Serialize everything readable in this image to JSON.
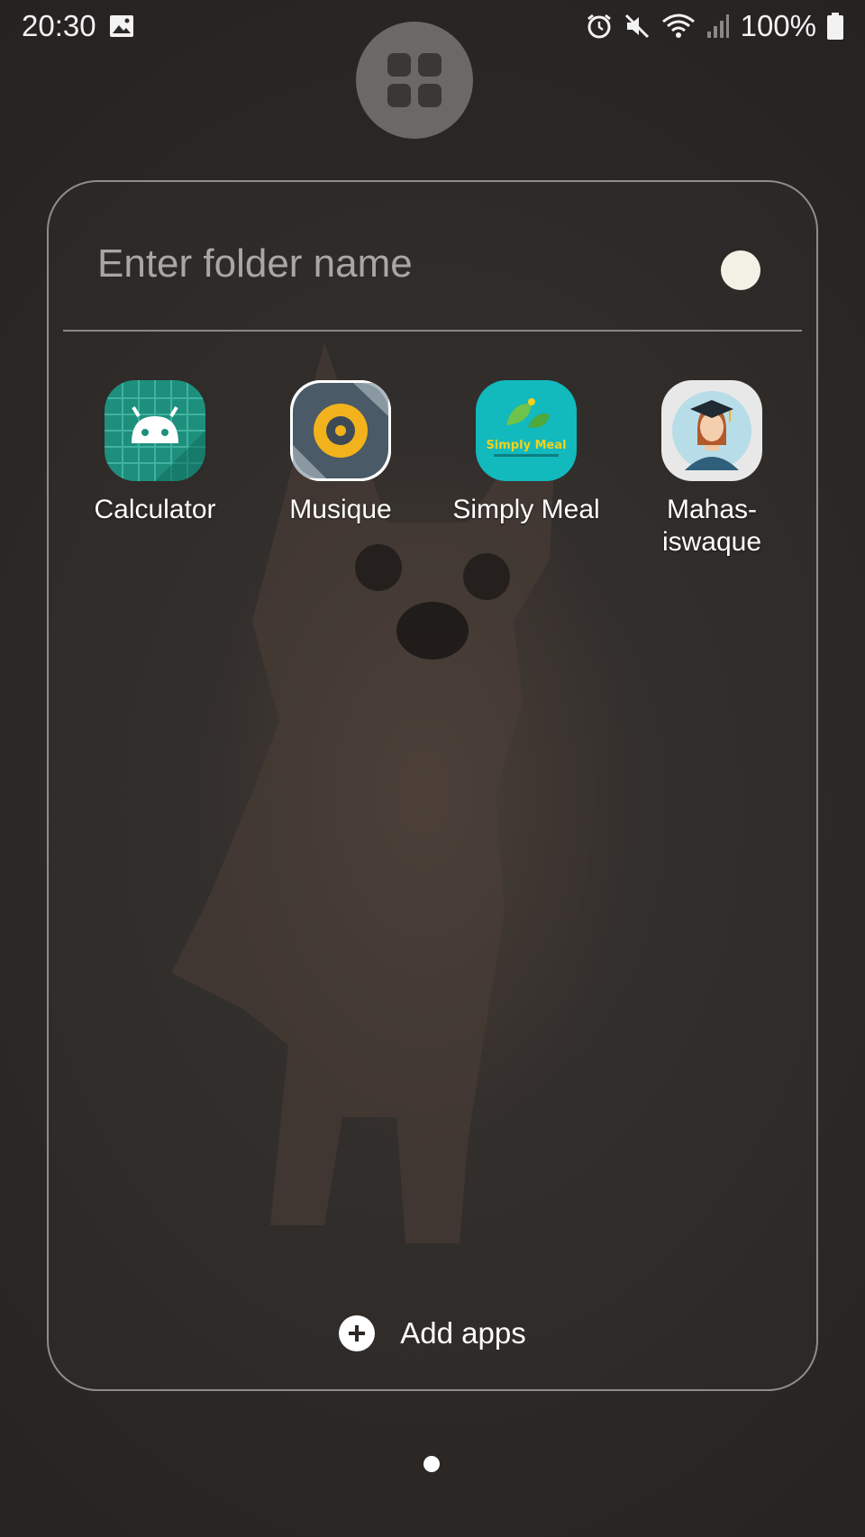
{
  "statusbar": {
    "time": "20:30",
    "battery_percent": "100%",
    "icons": [
      "gallery-icon",
      "alarm-icon",
      "mute-icon",
      "wifi-icon",
      "signal-icon",
      "battery-icon"
    ]
  },
  "apps_button": {
    "icon": "grid-icon"
  },
  "folder": {
    "name_placeholder": "Enter folder name",
    "name_value": "",
    "color_dot": "#f3f1e6",
    "apps": [
      {
        "label": "Calculator",
        "icon": "android-calculator-icon",
        "color": "#1e8f7d"
      },
      {
        "label": "Musique",
        "icon": "vinyl-disc-icon",
        "color": "#4a5a66"
      },
      {
        "label": "Simply Meal",
        "icon": "simply-meal-icon",
        "color": "#12b9bd",
        "logo_text": "Simply Meal"
      },
      {
        "label": "Mahas-\niswaque",
        "icon": "graduate-avatar-icon",
        "color": "#e6e6e6"
      }
    ],
    "add_apps_label": "Add apps"
  },
  "pager": {
    "pages": 1,
    "current": 1
  }
}
